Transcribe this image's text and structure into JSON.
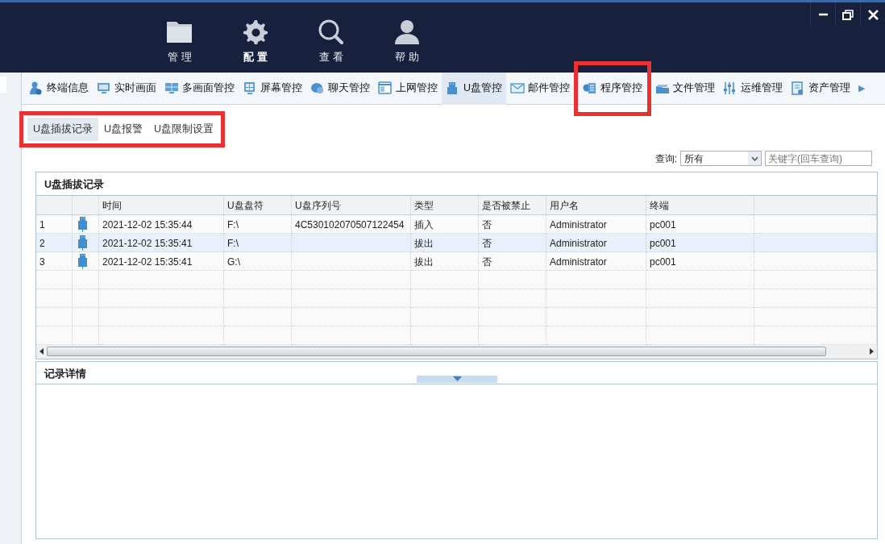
{
  "main_nav": [
    {
      "label": "管 理",
      "selected": false
    },
    {
      "label": "配 置",
      "selected": true
    },
    {
      "label": "查 看",
      "selected": false
    },
    {
      "label": "帮 助",
      "selected": false
    }
  ],
  "toolbar": {
    "items": [
      {
        "label": "终端信息",
        "selected": false,
        "highlighted": false
      },
      {
        "label": "实时画面",
        "selected": false,
        "highlighted": false
      },
      {
        "label": "多画面管控",
        "selected": false,
        "highlighted": false
      },
      {
        "label": "屏幕管控",
        "selected": false,
        "highlighted": false
      },
      {
        "label": "聊天管控",
        "selected": false,
        "highlighted": false
      },
      {
        "label": "上网管控",
        "selected": false,
        "highlighted": false
      },
      {
        "label": "U盘管控",
        "selected": true,
        "highlighted": false
      },
      {
        "label": "邮件管控",
        "selected": false,
        "highlighted": false
      },
      {
        "label": "程序管控",
        "selected": false,
        "highlighted": true
      },
      {
        "label": "文件管理",
        "selected": false,
        "highlighted": false
      },
      {
        "label": "运维管理",
        "selected": false,
        "highlighted": false
      },
      {
        "label": "资产管理",
        "selected": false,
        "highlighted": false
      }
    ],
    "more": "▶"
  },
  "subtabs": {
    "highlighted": true,
    "items": [
      {
        "label": "U盘插拔记录",
        "selected": true
      },
      {
        "label": "U盘报警",
        "selected": false
      },
      {
        "label": "U盘限制设置",
        "selected": false
      }
    ]
  },
  "query": {
    "label": "查询:",
    "value": "所有",
    "placeholder": "关键字(回车查询)"
  },
  "records_panel": {
    "title": "U盘插拔记录",
    "columns": [
      "时间",
      "U盘盘符",
      "U盘序列号",
      "类型",
      "是否被禁止",
      "用户名",
      "终端"
    ],
    "rows": [
      {
        "index": "1",
        "selected": false,
        "cells": [
          "2021-12-02 15:35:44",
          "F:\\",
          "4C530102070507122454",
          "插入",
          "否",
          "Administrator",
          "pc001"
        ]
      },
      {
        "index": "2",
        "selected": true,
        "cells": [
          "2021-12-02 15:35:41",
          "F:\\",
          "",
          "拔出",
          "否",
          "Administrator",
          "pc001"
        ]
      },
      {
        "index": "3",
        "selected": false,
        "cells": [
          "2021-12-02 15:35:41",
          "G:\\",
          "",
          "拔出",
          "否",
          "Administrator",
          "pc001"
        ]
      }
    ]
  },
  "detail_panel": {
    "title": "记录详情"
  }
}
